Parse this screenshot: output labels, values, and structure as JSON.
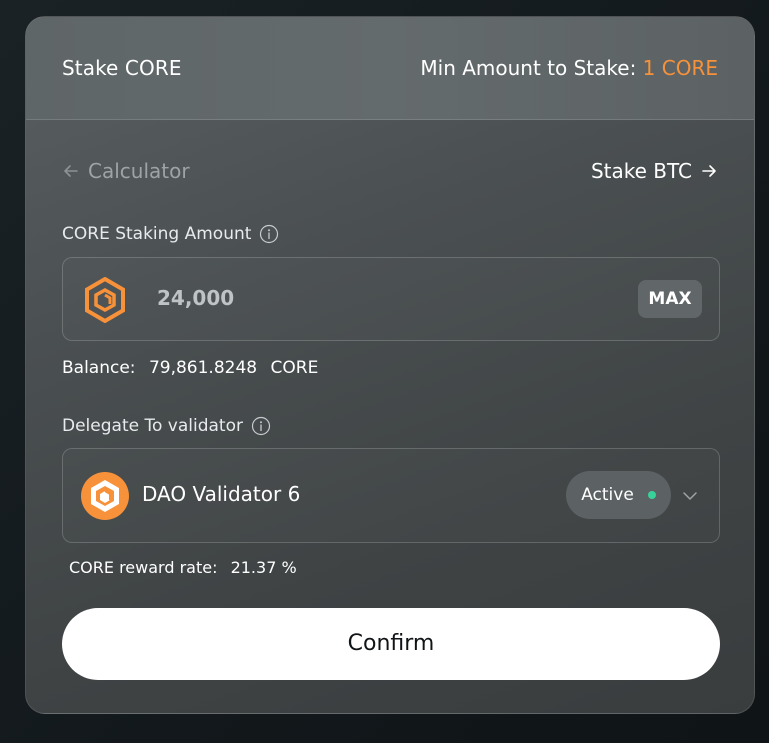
{
  "header": {
    "title": "Stake CORE",
    "min_label": "Min Amount to Stake: ",
    "min_value": "1 CORE",
    "accent_color": "#f7923a"
  },
  "nav": {
    "back_label": "Calculator",
    "back_icon": "arrow-left-icon",
    "forward_label": "Stake BTC",
    "forward_icon": "arrow-right-icon"
  },
  "amount": {
    "label": "CORE Staking Amount",
    "info_icon": "info-icon",
    "token_icon": "core-token-icon",
    "value": "24,000",
    "max_label": "MAX"
  },
  "balance": {
    "label": "Balance:",
    "value": "79,861.8248",
    "unit": "CORE"
  },
  "delegate": {
    "label": "Delegate To validator",
    "info_icon": "info-icon",
    "validator_icon": "validator-logo-icon",
    "validator_name": "DAO Validator 6",
    "status": "Active",
    "status_color": "#38d19a",
    "dropdown_icon": "chevron-down-icon"
  },
  "reward": {
    "label": "CORE reward rate:",
    "value": "21.37 %"
  },
  "confirm": {
    "label": "Confirm"
  }
}
